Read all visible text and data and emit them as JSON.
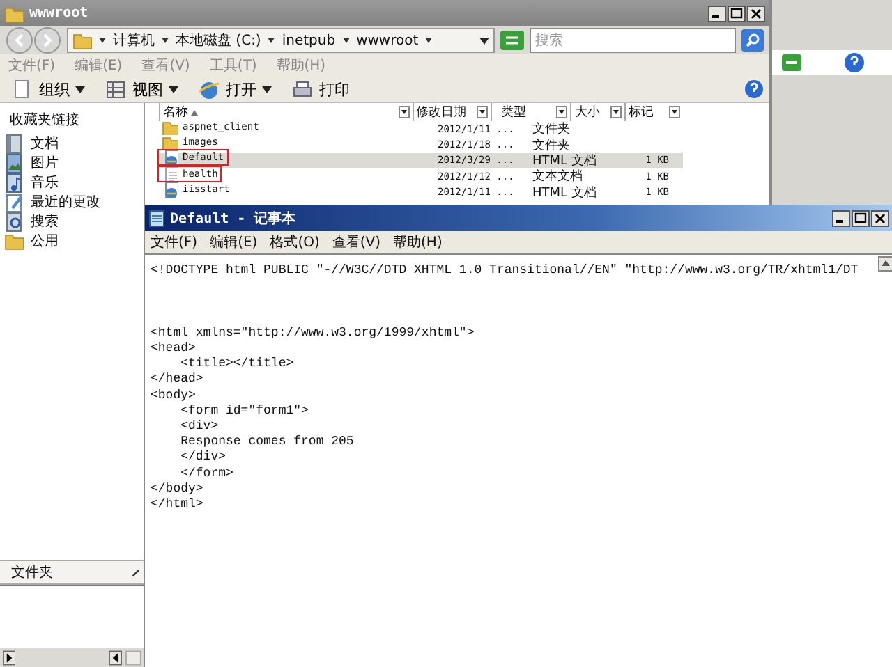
{
  "explorer": {
    "title": "wwwroot",
    "breadcrumb": [
      "计算机",
      "本地磁盘 (C:)",
      "inetpub",
      "wwwroot"
    ],
    "search": {
      "placeholder": "搜索"
    },
    "menu": [
      {
        "label": "文件(F)",
        "disabled": true
      },
      {
        "label": "编辑(E)",
        "disabled": true
      },
      {
        "label": "查看(V)",
        "disabled": true
      },
      {
        "label": "工具(T)",
        "disabled": true
      },
      {
        "label": "帮助(H)",
        "disabled": true
      }
    ],
    "toolbar": [
      {
        "label": "组织",
        "kind": "organize",
        "dropdown": true
      },
      {
        "label": "视图",
        "kind": "views",
        "dropdown": true
      },
      {
        "label": "打开",
        "kind": "open",
        "dropdown": true
      },
      {
        "label": "打印",
        "kind": "print",
        "dropdown": false
      }
    ],
    "favorites": {
      "title": "收藏夹链接",
      "items": [
        {
          "label": "文档",
          "kind": "doc"
        },
        {
          "label": "图片",
          "kind": "pic"
        },
        {
          "label": "音乐",
          "kind": "music"
        },
        {
          "label": "最近的更改",
          "kind": "recent"
        },
        {
          "label": "搜索",
          "kind": "search"
        },
        {
          "label": "公用",
          "kind": "folder"
        }
      ]
    },
    "folders_bar": {
      "label": "文件夹"
    },
    "table": {
      "columns": [
        "名称",
        "修改日期",
        "类型",
        "大小",
        "标记"
      ],
      "rows": [
        {
          "kind": "folder",
          "name": "aspnet_client",
          "date": "2012/1/11 ...",
          "type": "文件夹",
          "size": "",
          "selected": false,
          "marked": false
        },
        {
          "kind": "folder",
          "name": "images",
          "date": "2012/1/18 ...",
          "type": "文件夹",
          "size": "",
          "selected": false,
          "marked": false
        },
        {
          "kind": "html",
          "name": "Default",
          "date": "2012/3/29 ...",
          "type": "HTML 文档",
          "size": "1 KB",
          "selected": true,
          "marked": true
        },
        {
          "kind": "text",
          "name": "health",
          "date": "2012/1/12 ...",
          "type": "文本文档",
          "size": "1 KB",
          "selected": false,
          "marked": true
        },
        {
          "kind": "html",
          "name": "iisstart",
          "date": "2012/1/11 ...",
          "type": "HTML 文档",
          "size": "1 KB",
          "selected": false,
          "marked": false
        }
      ]
    }
  },
  "notepad": {
    "title": "Default - 记事本",
    "menu": [
      "文件(F)",
      "编辑(E)",
      "格式(O)",
      "查看(V)",
      "帮助(H)"
    ],
    "text": "<!DOCTYPE html PUBLIC \"-//W3C//DTD XHTML 1.0 Transitional//EN\" \"http://www.w3.org/TR/xhtml1/DT\n\n\n\n<html xmlns=\"http://www.w3.org/1999/xhtml\">\n<head>\n    <title></title>\n</head>\n<body>\n    <form id=\"form1\">\n    <div>\n    Response comes from 205\n    </div>\n    </form>\n</body>\n</html>"
  }
}
